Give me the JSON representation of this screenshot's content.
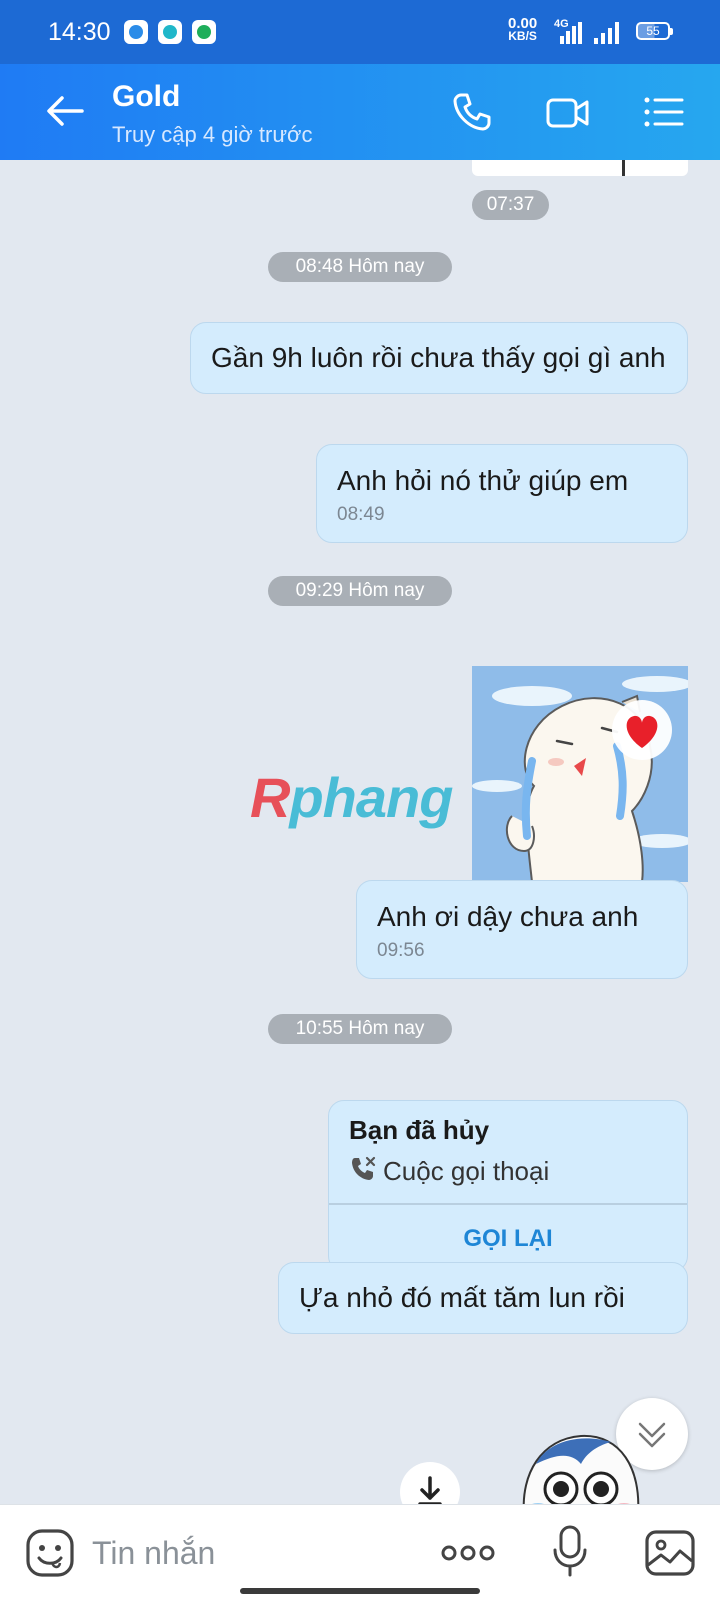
{
  "status_bar": {
    "time": "14:30",
    "net_speed_value": "0.00",
    "net_speed_unit": "KB/S",
    "network_type": "4G",
    "battery": "55",
    "app_icons": [
      "blue-app-icon",
      "chat-app-icon",
      "shield-app-icon"
    ]
  },
  "header": {
    "contact_name": "Gold",
    "status": "Truy cập 4 giờ trước",
    "icons": [
      "back-arrow-icon",
      "phone-icon",
      "video-icon",
      "menu-icon"
    ]
  },
  "messages": {
    "top_sticker_time": "07:37",
    "date_1": "08:48 Hôm nay",
    "msg_1": "Gần 9h luôn rồi chưa thấy gọi gì anh",
    "msg_2": "Anh hỏi nó thử giúp em",
    "msg_2_time": "08:49",
    "date_2": "09:29 Hôm nay",
    "msg_3": "Anh ơi dậy chưa anh",
    "msg_3_time": "09:56",
    "date_3": "10:55 Hôm nay",
    "call_title": "Bạn đã hủy",
    "call_type": "Cuộc gọi thoại",
    "call_back": "GỌI LẠI",
    "msg_4": "Ựa nhỏ đó mất tăm lun rồi"
  },
  "watermark": {
    "first": "R",
    "rest": "phang"
  },
  "input_bar": {
    "placeholder": "Tin nhắn",
    "icons": [
      "emoji-icon",
      "more-icon",
      "mic-icon",
      "image-icon"
    ]
  },
  "colors": {
    "header_start": "#1f7bf4",
    "header_end": "#26a7ef",
    "bubble": "#d4ecfd",
    "chat_background": "#e2e8f0",
    "call_back_text": "#1e86d6"
  }
}
